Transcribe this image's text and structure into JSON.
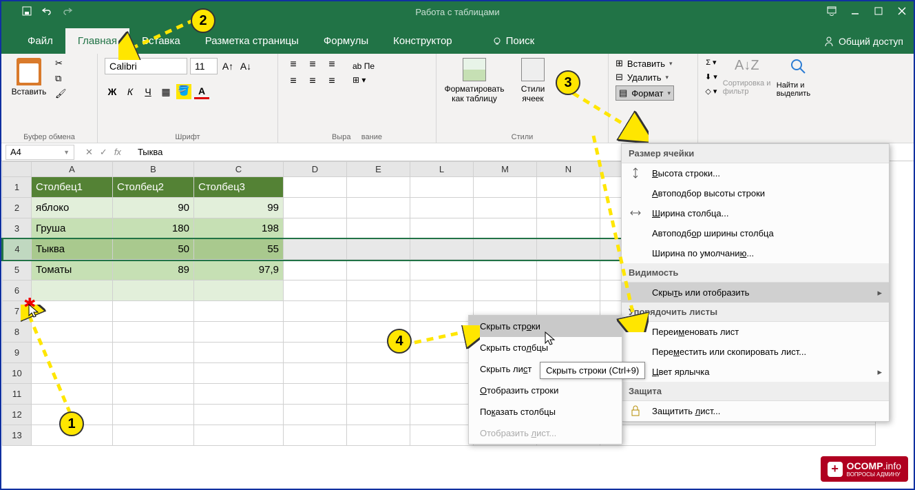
{
  "titlebar": {
    "center": "Работа с таблицами"
  },
  "tabs": {
    "file": "Файл",
    "home": "Главная",
    "insert": "Вставка",
    "layout": "Разметка страницы",
    "formulas": "Формулы",
    "design": "Конструктор",
    "search": "Поиск",
    "share": "Общий доступ"
  },
  "ribbon": {
    "clipboard": {
      "paste": "Вставить",
      "label": "Буфер обмена"
    },
    "font": {
      "name": "Calibri",
      "size": "11",
      "label": "Шрифт"
    },
    "align": {
      "wrap": "Пе",
      "label": "Выра"
    },
    "align_cond": {
      "label": "вание"
    },
    "styles": {
      "format_as_table": "Форматировать как таблицу",
      "cell_styles": "Стили ячеек",
      "label": "Стили"
    },
    "cells": {
      "insert": "Вставить",
      "delete": "Удалить",
      "format": "Формат"
    },
    "editing": {
      "sort": "Сортировка и фильтр",
      "find": "Найти и выделить"
    }
  },
  "formula_bar": {
    "ref": "A4",
    "value": "Тыква",
    "fx": "fx"
  },
  "grid": {
    "cols": [
      "A",
      "B",
      "C",
      "D",
      "E",
      "L",
      "M",
      "N"
    ],
    "rows": [
      "1",
      "2",
      "3",
      "4",
      "5",
      "6",
      "7",
      "8",
      "9",
      "10",
      "11",
      "12",
      "13"
    ],
    "headers": [
      "Столбец1",
      "Столбец2",
      "Столбец3"
    ],
    "data": [
      [
        "яблоко",
        "90",
        "99"
      ],
      [
        "Груша",
        "180",
        "198"
      ],
      [
        "Тыква",
        "50",
        "55"
      ],
      [
        "Томаты",
        "89",
        "97,9"
      ]
    ]
  },
  "format_menu": {
    "sections": {
      "size": "Размер ячейки",
      "visibility": "Видимость",
      "sheets": "Упорядочить листы",
      "protect": "Защита"
    },
    "items": {
      "row_height": "Высота строки...",
      "autofit_row": "Автоподбор высоты строки",
      "col_width": "Ширина столбца...",
      "autofit_col": "Автоподбор ширины столбца",
      "default_width": "Ширина по умолчанию...",
      "hide_show": "Скрыть или отобразить",
      "rename_sheet": "Переименовать лист",
      "move_copy": "Переместить или скопировать лист...",
      "tab_color": "Цвет ярлычка",
      "protect_sheet": "Защитить лист..."
    }
  },
  "submenu": {
    "hide_rows": "Скрыть строки",
    "hide_cols": "Скрыть столбцы",
    "hide_sheet": "Скрыть лист",
    "show_rows": "Отобразить строки",
    "show_cols": "Показать столбцы",
    "show_sheet": "Отобразить лист..."
  },
  "tooltip": "Скрыть строки (Ctrl+9)",
  "callouts": {
    "1": "1",
    "2": "2",
    "3": "3",
    "4": "4"
  },
  "watermark": {
    "brand": "OCOMP",
    "tld": ".info",
    "sub": "ВОПРОСЫ АДМИНУ"
  }
}
